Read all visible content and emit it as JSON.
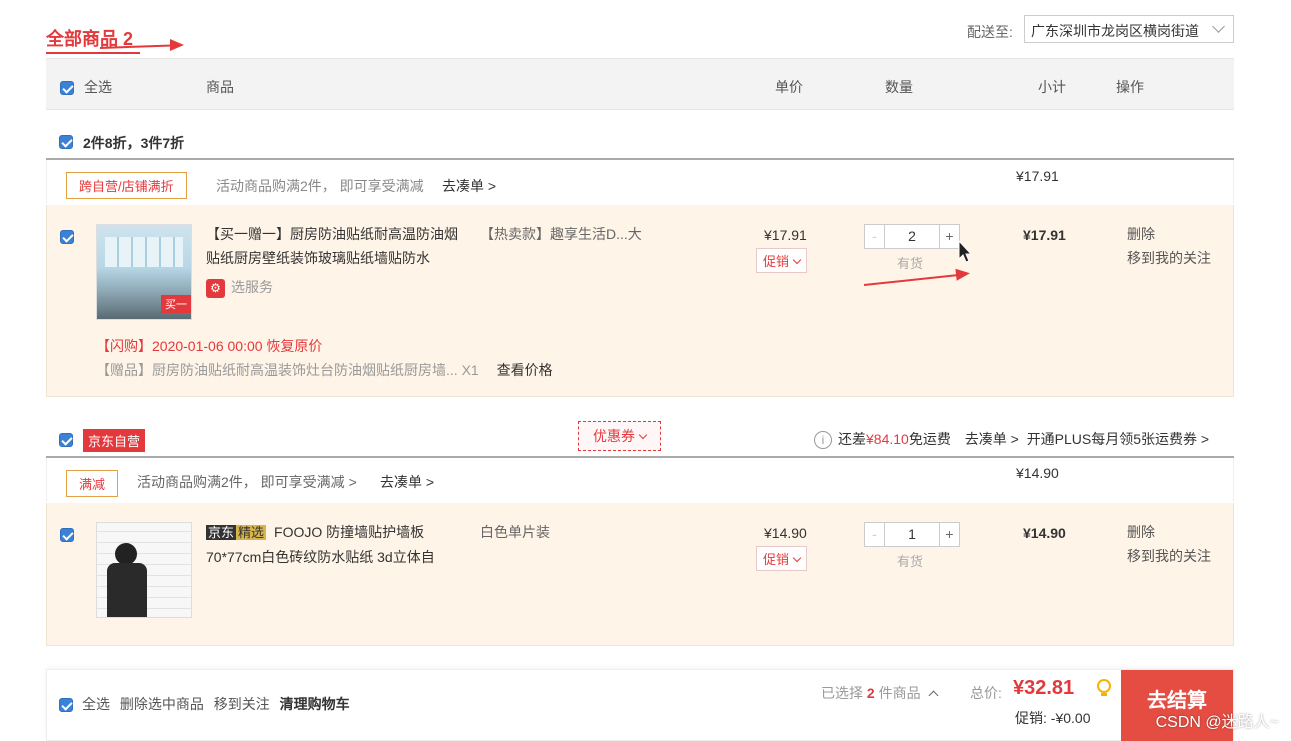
{
  "header": {
    "title": "全部商品",
    "count": "2",
    "deliver_label": "配送至:",
    "deliver_value": "广东深圳市龙岗区横岗街道"
  },
  "table_header": {
    "select_all": "全选",
    "product": "商品",
    "unit_price": "单价",
    "quantity": "数量",
    "subtotal": "小计",
    "actions": "操作"
  },
  "section1": {
    "promo_title": "2件8折，3件7折",
    "tag": "跨自营/店铺满折",
    "promo_desc": "活动商品购满2件， 即可享受满减",
    "go_add": "去凑单 >",
    "group_total": "¥17.91",
    "item": {
      "name": "【买一赠一】厨房防油贴纸耐高温防油烟贴纸厨房壁纸装饰玻璃贴纸墙贴防水",
      "props": "【热卖款】趣享生活D...大",
      "service": "选服务",
      "price": "¥17.91",
      "promo": "促销",
      "qty_minus": "-",
      "qty": "2",
      "qty_plus": "+",
      "stock": "有货",
      "subtotal": "¥17.91",
      "delete": "删除",
      "move_to_fav": "移到我的关注",
      "flash": "【闪购】2020-01-06 00:00 恢复原价",
      "gift": "【赠品】厨房防油贴纸耐高温装饰灶台防油烟贴纸厨房墙...",
      "gift_qty": "X1",
      "view_price": "查看价格",
      "thumb_label": "买一"
    }
  },
  "section2": {
    "shop_badge": "京东自营",
    "coupon": "优惠券",
    "freight_prefix": "还差",
    "freight_amount": "¥84.10",
    "freight_suffix": "免运费",
    "go_add": "去凑单 >",
    "plus": "开通PLUS每月领5张运费券 >",
    "tag": "满减",
    "promo_desc": "活动商品购满2件， 即可享受满减 >",
    "go_add2": "去凑单 >",
    "group_total": "¥14.90",
    "item": {
      "brand1": "京东",
      "brand2": "精选",
      "name": "FOOJO 防撞墙贴护墙板70*77cm白色砖纹防水贴纸 3d立体自",
      "props": "白色单片装",
      "price": "¥14.90",
      "promo": "促销",
      "qty_minus": "-",
      "qty": "1",
      "qty_plus": "+",
      "stock": "有货",
      "subtotal": "¥14.90",
      "delete": "删除",
      "move_to_fav": "移到我的关注"
    }
  },
  "footer": {
    "select_all": "全选",
    "delete_selected": "删除选中商品",
    "move_to_fav": "移到关注",
    "clear_cart": "清理购物车",
    "selected_prefix": "已选择",
    "selected_count": "2",
    "selected_suffix": "件商品",
    "total_label": "总价:",
    "total": "¥32.81",
    "discount_label": "促销:",
    "discount": "-¥0.00",
    "checkout": "去结算"
  },
  "watermark": "CSDN @迷路人~",
  "colors": {
    "accent": "#e4393c",
    "checkout": "#e54d42",
    "item_bg": "#fff4e8"
  }
}
